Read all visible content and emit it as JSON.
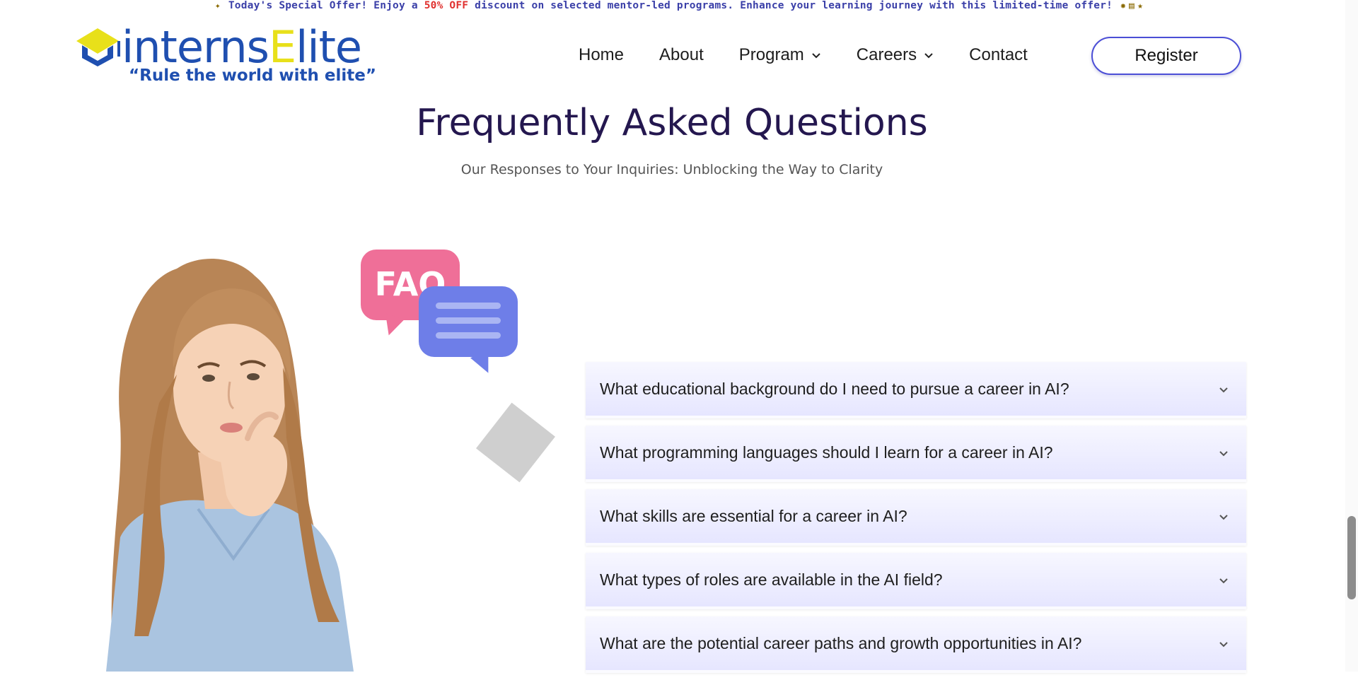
{
  "promo": {
    "icon_start": "party-popper-icon",
    "text_before": "Today's Special Offer! Enjoy a ",
    "highlight": "50% OFF",
    "text_after": " discount on selected mentor-led programs. Enhance your learning journey with this limited-time offer!",
    "icons_end": [
      "sparkle-icon",
      "book-icon",
      "star-icon"
    ]
  },
  "logo": {
    "word_part1": "interns",
    "word_part2": "E",
    "word_part3": "lite",
    "tagline": "“Rule the world with elite”",
    "colors": {
      "blue": "#1f4fb0",
      "yellow": "#e8e01a"
    }
  },
  "nav": {
    "items": [
      {
        "label": "Home",
        "dropdown": false
      },
      {
        "label": "About",
        "dropdown": false
      },
      {
        "label": "Program",
        "dropdown": true
      },
      {
        "label": "Careers",
        "dropdown": true
      },
      {
        "label": "Contact",
        "dropdown": false
      }
    ],
    "register_label": "Register"
  },
  "faq": {
    "title": "Frequently Asked Questions",
    "subtitle": "Our Responses to Your Inquiries: Unblocking the Way to Clarity",
    "badge_text": "FAQ",
    "questions": [
      "What educational background do I need to pursue a career in AI?",
      "What programming languages should I learn for a career in AI?",
      "What skills are essential for a career in AI?",
      "What types of roles are available in the AI field?",
      "What are the potential career paths and growth opportunities in AI?"
    ]
  },
  "colors": {
    "accent": "#4b4ed6",
    "heading": "#24174f",
    "faq_pink": "#ef6f98",
    "chat_blue": "#6e7ee8",
    "accordion_bg": "#e6e6ff"
  }
}
